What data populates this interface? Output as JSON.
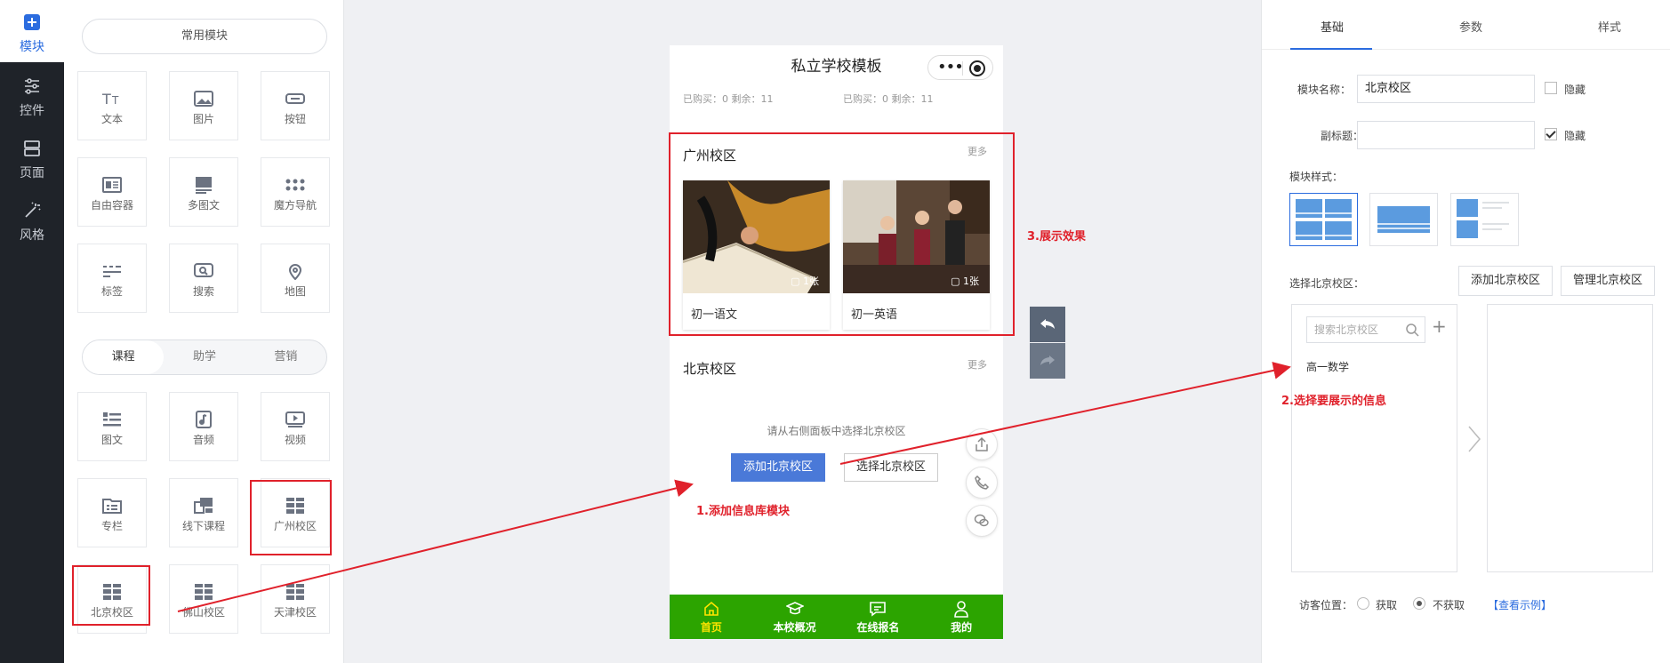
{
  "nav": {
    "items": [
      {
        "label": "模块",
        "icon": "plus-square-icon"
      },
      {
        "label": "控件",
        "icon": "sliders-icon"
      },
      {
        "label": "页面",
        "icon": "pages-icon"
      },
      {
        "label": "风格",
        "icon": "magic-wand-icon"
      }
    ]
  },
  "modules": {
    "common_label": "常用模块",
    "common": [
      {
        "label": "文本",
        "icon": "text-icon"
      },
      {
        "label": "图片",
        "icon": "image-icon"
      },
      {
        "label": "按钮",
        "icon": "button-icon"
      },
      {
        "label": "自由容器",
        "icon": "container-icon"
      },
      {
        "label": "多图文",
        "icon": "multi-image-icon"
      },
      {
        "label": "魔方导航",
        "icon": "cube-nav-icon"
      },
      {
        "label": "标签",
        "icon": "tag-icon"
      },
      {
        "label": "搜索",
        "icon": "search-icon"
      },
      {
        "label": "地图",
        "icon": "map-pin-icon"
      }
    ],
    "tabs": [
      "课程",
      "助学",
      "营销"
    ],
    "course": [
      {
        "label": "图文",
        "icon": "article-icon"
      },
      {
        "label": "音频",
        "icon": "audio-icon"
      },
      {
        "label": "视频",
        "icon": "video-icon"
      },
      {
        "label": "专栏",
        "icon": "column-icon"
      },
      {
        "label": "线下课程",
        "icon": "offline-course-icon"
      },
      {
        "label": "广州校区",
        "icon": "grid-icon"
      },
      {
        "label": "北京校区",
        "icon": "grid-icon"
      },
      {
        "label": "佛山校区",
        "icon": "grid-icon"
      },
      {
        "label": "天津校区",
        "icon": "grid-icon"
      }
    ]
  },
  "phone": {
    "title": "私立学校模板",
    "bought_left": "已购买：0 剩余：11",
    "bought_right": "已购买：0 剩余：11",
    "guangzhou": {
      "title": "广州校区",
      "more": "更多",
      "cards": [
        {
          "name": "初一语文",
          "count": "1张"
        },
        {
          "name": "初一英语",
          "count": "1张"
        }
      ]
    },
    "beijing": {
      "title": "北京校区",
      "more": "更多",
      "hint": "请从右侧面板中选择北京校区",
      "add_btn": "添加北京校区",
      "select_btn": "选择北京校区"
    },
    "tabbar": [
      {
        "label": "首页",
        "icon": "home-icon"
      },
      {
        "label": "本校概况",
        "icon": "graduation-cap-icon"
      },
      {
        "label": "在线报名",
        "icon": "message-icon"
      },
      {
        "label": "我的",
        "icon": "user-icon"
      }
    ]
  },
  "panel": {
    "tabs": [
      "基础",
      "参数",
      "样式"
    ],
    "name_label": "模块名称：",
    "name_value": "北京校区",
    "subtitle_label": "副标题：",
    "subtitle_value": "",
    "hide_label": "隐藏",
    "style_label": "模块样式：",
    "select_label": "选择北京校区：",
    "add_btn": "添加北京校区",
    "manage_btn": "管理北京校区",
    "search_placeholder": "搜索北京校区",
    "list_items": [
      "高一数学"
    ],
    "visitor_label": "访客位置：",
    "radio_get": "获取",
    "radio_noget": "不获取",
    "example_link": "【查看示例】"
  },
  "annotations": {
    "a1": "1.添加信息库模块",
    "a2": "2.选择要展示的信息",
    "a3": "3.展示效果"
  },
  "colors": {
    "accent": "#2b6cdf",
    "tabbar": "#2ca400",
    "annotation": "#e0212b"
  }
}
